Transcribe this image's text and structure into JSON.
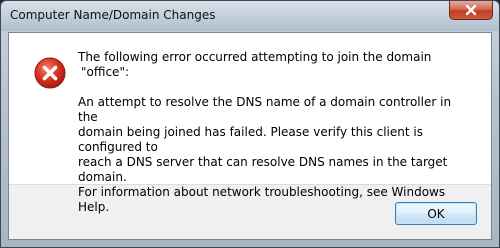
{
  "window": {
    "title": "Computer Name/Domain Changes"
  },
  "message": {
    "line1": "The following error occurred attempting to join the domain",
    "line2": "\"office\":",
    "line3": "An attempt to resolve the DNS name of a domain controller in the",
    "line4": "domain being joined has failed.  Please verify this client is configured to",
    "line5": "reach a DNS server that can resolve DNS names in the target domain.",
    "line6": "For information about network troubleshooting, see Windows Help."
  },
  "buttons": {
    "ok_label": "OK"
  },
  "icons": {
    "error": "error-icon",
    "close": "close-icon"
  },
  "colors": {
    "error_red": "#d9301f",
    "close_red": "#c13d22",
    "button_border": "#3c7fb1"
  }
}
